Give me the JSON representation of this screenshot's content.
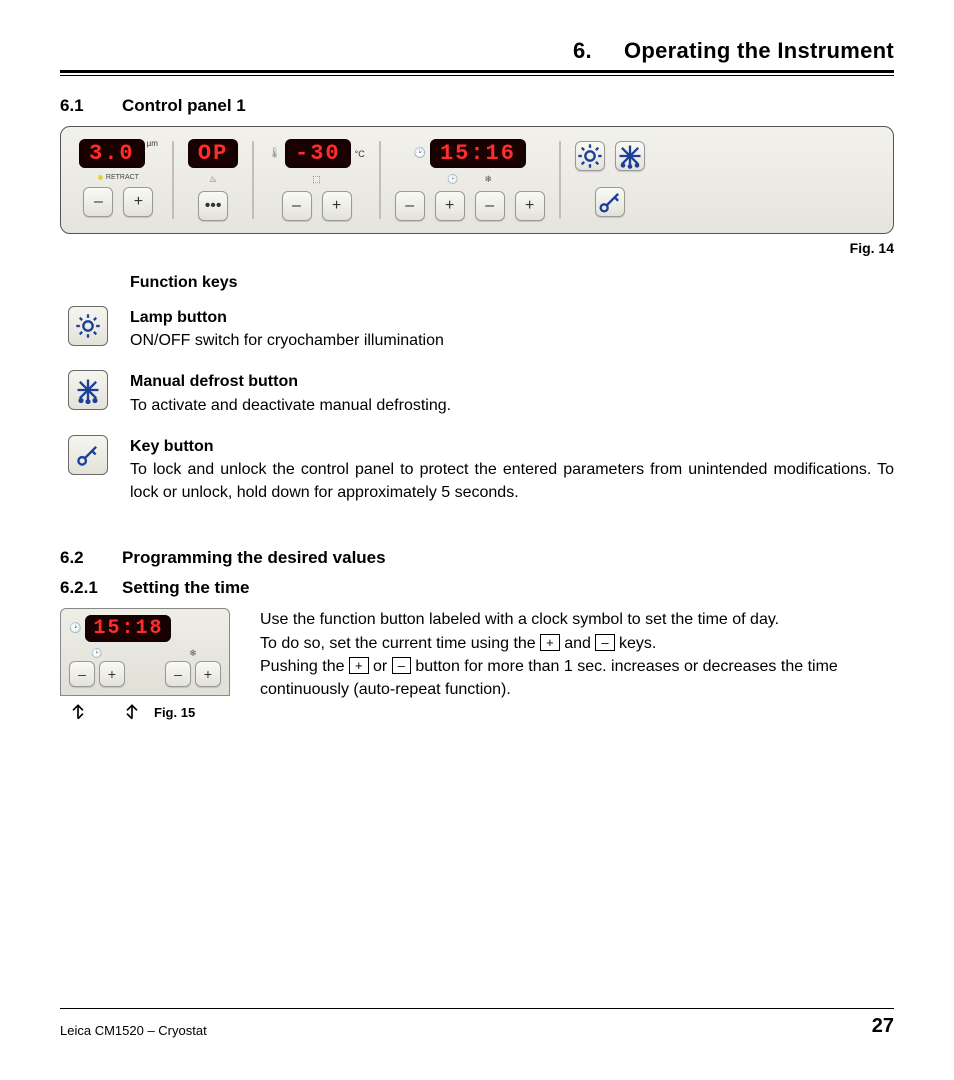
{
  "chapter": {
    "num": "6.",
    "title": "Operating the Instrument"
  },
  "sec61": {
    "num": "6.1",
    "title": "Control panel 1"
  },
  "panel": {
    "thickness": "3.0",
    "thickness_unit": "µm",
    "retract_label": "RETRACT",
    "op": "OP",
    "temp": "-30",
    "temp_unit": "°C",
    "time": "15:16",
    "minus": "–",
    "plus": "+",
    "dots": "•••"
  },
  "fig14": "Fig. 14",
  "fk_title": "Function keys",
  "fk": {
    "lamp": {
      "title": "Lamp button",
      "text": "ON/OFF switch for cryochamber illumination"
    },
    "defrost": {
      "title": "Manual defrost button",
      "text": "To activate and deactivate manual defrosting."
    },
    "key": {
      "title": "Key button",
      "text": "To lock and unlock the control panel to protect the entered parameters from unintended modifications. To lock or unlock, hold down for approximately 5 seconds."
    }
  },
  "sec62": {
    "num": "6.2",
    "title": "Programming the desired values"
  },
  "sec621": {
    "num": "6.2.1",
    "title": "Setting the time"
  },
  "timefig": {
    "time": "15:18",
    "label": "Fig. 15"
  },
  "timetext": {
    "l1": "Use the function button labeled with a clock symbol to set the time of day.",
    "l2a": "To do so, set the current time using the ",
    "l2b": " and ",
    "l2c": " keys.",
    "l3a": "Pushing the ",
    "l3b": " or ",
    "l3c": " button for more than 1 sec. increases or decreases the time continuously (auto-repeat function).",
    "plus": "+",
    "minus": "–"
  },
  "footer": {
    "doc": "Leica CM1520 – Cryostat",
    "page": "27"
  }
}
